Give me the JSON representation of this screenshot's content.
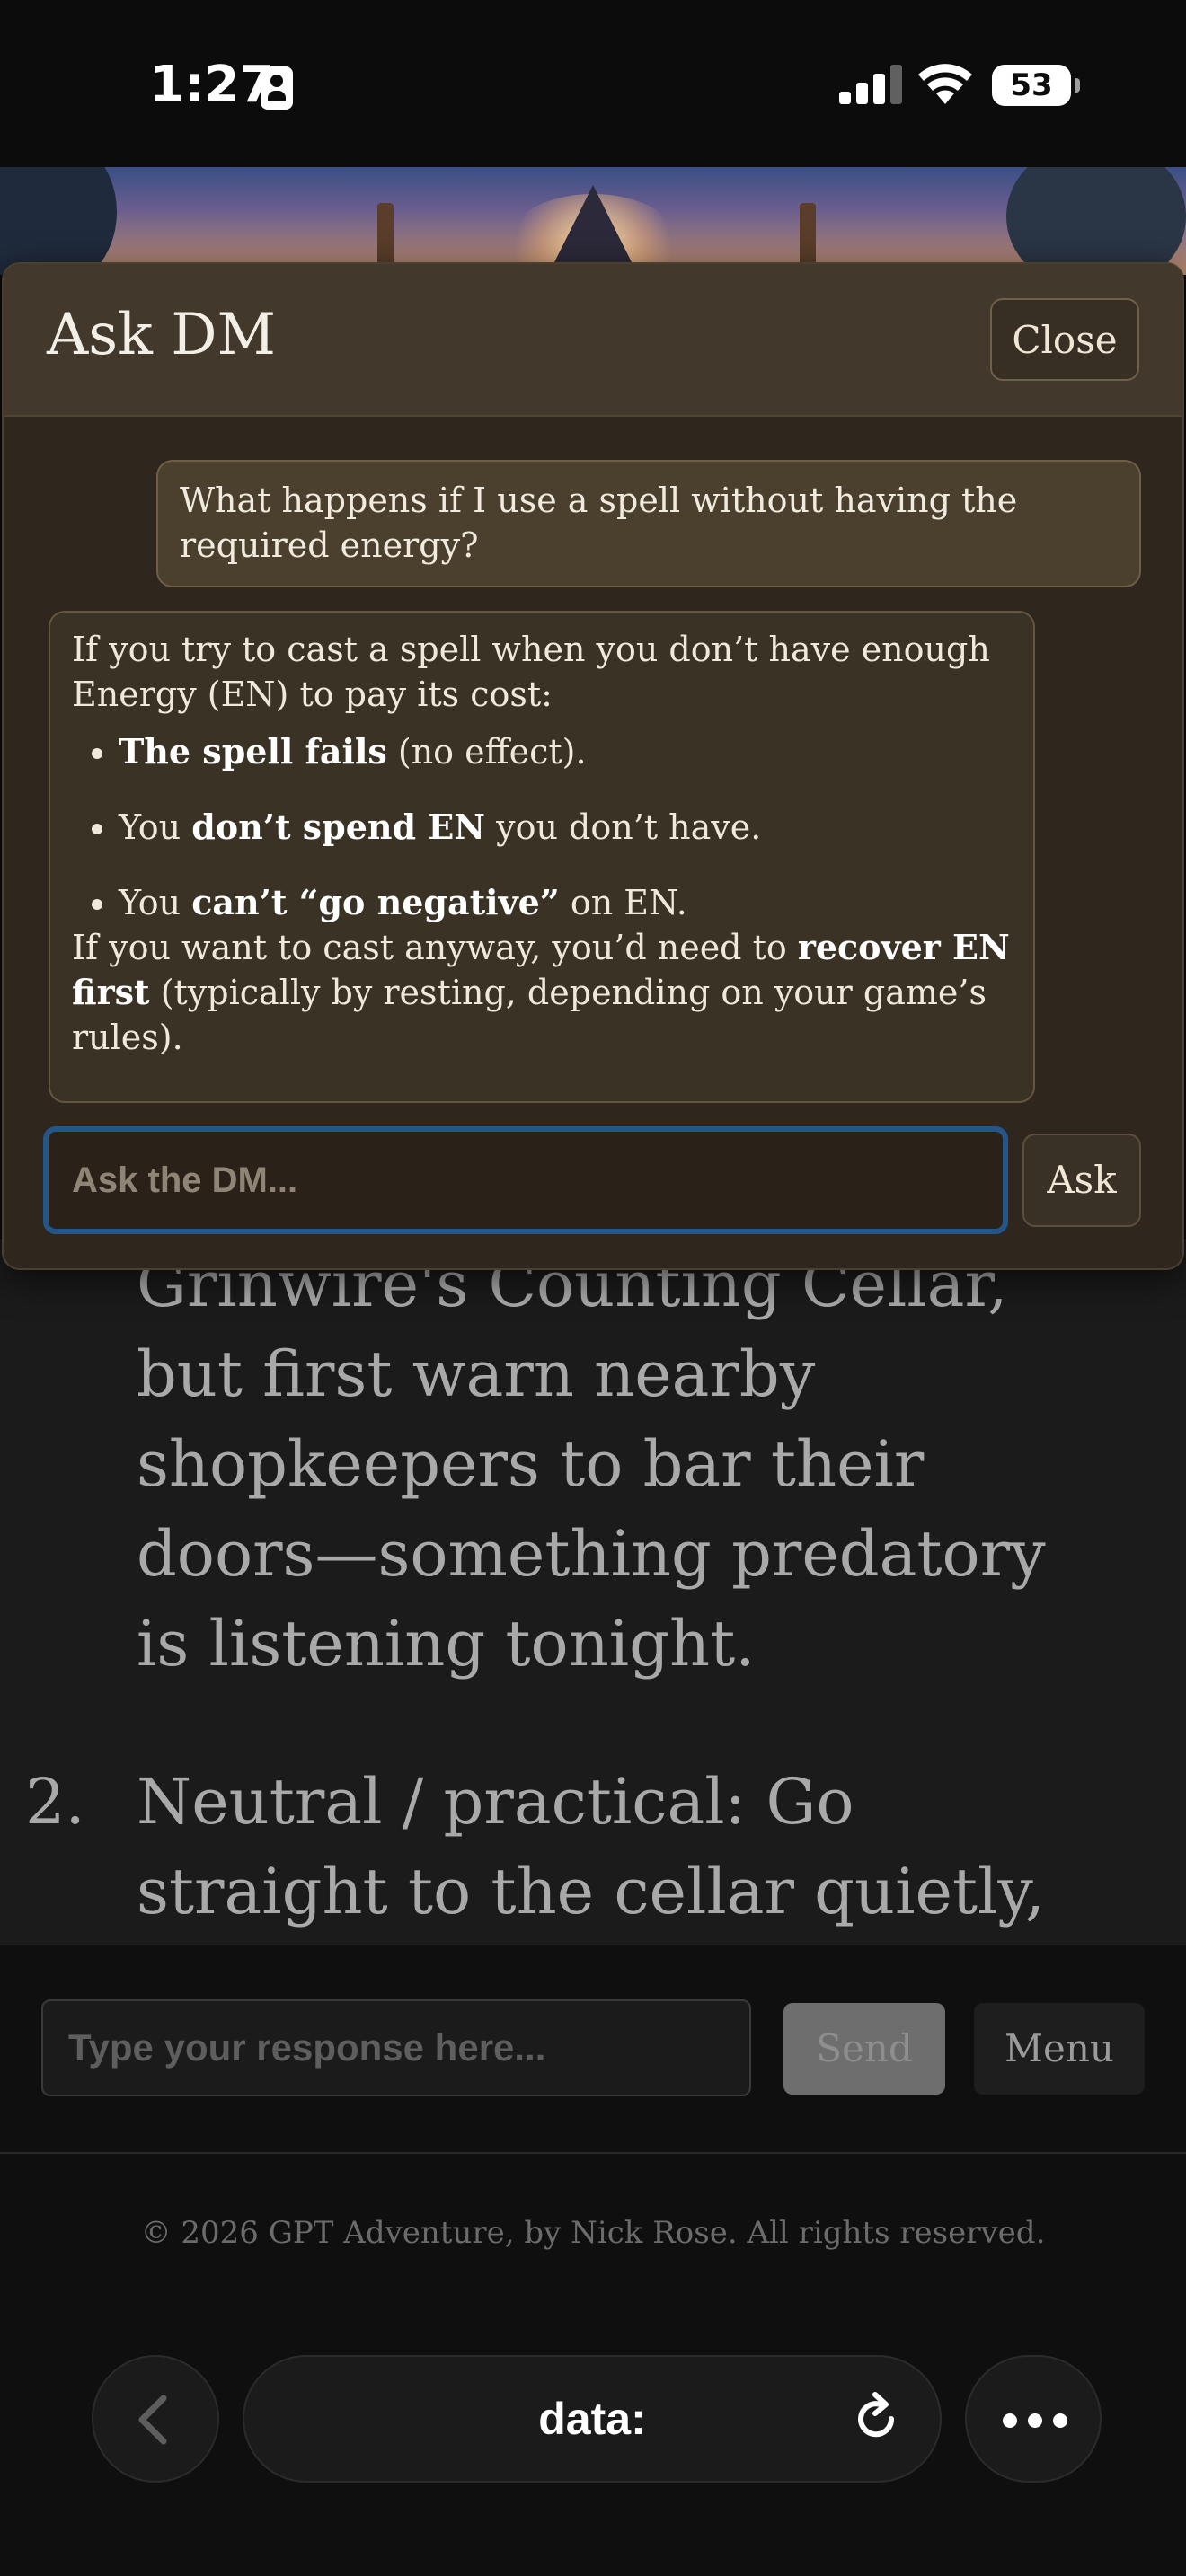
{
  "status_bar": {
    "time": "1:27",
    "battery": "53"
  },
  "story": {
    "item1_text": "Grinwire's Counting Cellar,\nbut first warn nearby\nshopkeepers to bar their\ndoors—something predatory\nis listening tonight.",
    "item2_number": "2.",
    "item2_text": "Neutral / practical: Go\nstraight to the cellar quietly,"
  },
  "response_bar": {
    "placeholder": "Type your response here...",
    "send_label": "Send",
    "menu_label": "Menu"
  },
  "footer": {
    "text": "© 2026 GPT Adventure, by Nick Rose. All rights reserved."
  },
  "browser": {
    "url": "data:"
  },
  "modal": {
    "title": "Ask DM",
    "close_label": "Close",
    "user_message": "What happens if I use a spell without having the required energy?",
    "dm_reply": {
      "intro": "If you try to cast a spell when you don’t have enough Energy (EN) to pay its cost:",
      "b1_strong": "The spell fails",
      "b1_rest": " (no effect).",
      "b2_pre": "You ",
      "b2_strong": "don’t spend EN",
      "b2_post": " you don’t have.",
      "b3_pre": "You ",
      "b3_strong": "can’t “go negative”",
      "b3_post": " on EN.",
      "outro_pre": "If you want to cast anyway, you’d need to ",
      "outro_strong": "recover EN first",
      "outro_post": " (typically by resting, depending on your game’s rules)."
    },
    "ask_placeholder": "Ask the DM...",
    "ask_label": "Ask"
  }
}
